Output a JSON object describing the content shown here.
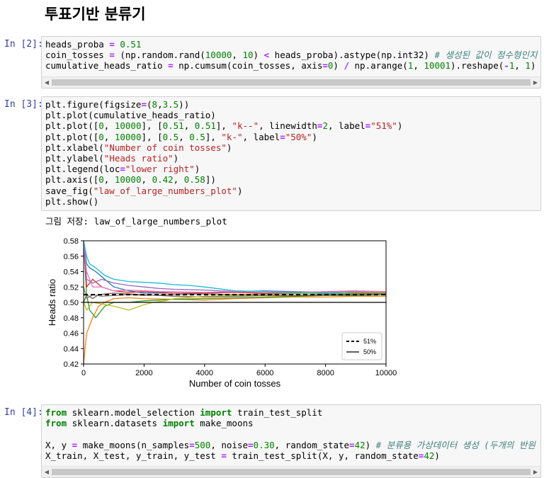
{
  "heading": "투표기반 분류기",
  "cells": {
    "c2": {
      "prompt": "In [2]:",
      "lines": [
        [
          [
            "heads_proba ",
            ""
          ],
          [
            "=",
            "op"
          ],
          [
            " ",
            ""
          ],
          [
            "0.51",
            "num"
          ]
        ],
        [
          [
            "coin_tosses ",
            ""
          ],
          [
            "=",
            "op"
          ],
          [
            " (np.random.rand(",
            ""
          ],
          [
            "10000",
            "num"
          ],
          [
            ", ",
            ""
          ],
          [
            "10",
            "num"
          ],
          [
            ") ",
            ""
          ],
          [
            "<",
            "op"
          ],
          [
            " heads_proba).astype(np.int32) ",
            ""
          ],
          [
            "# 생성된 값이 정수형인지 확",
            "cm"
          ]
        ],
        [
          [
            "cumulative_heads_ratio ",
            ""
          ],
          [
            "=",
            "op"
          ],
          [
            " np.cumsum(coin_tosses, axis",
            ""
          ],
          [
            "=",
            "op"
          ],
          [
            "0",
            "num"
          ],
          [
            ") ",
            ""
          ],
          [
            "/",
            "op"
          ],
          [
            " np.arange(",
            ""
          ],
          [
            "1",
            "num"
          ],
          [
            ", ",
            ""
          ],
          [
            "10001",
            "num"
          ],
          [
            ").reshape(",
            ""
          ],
          [
            "-",
            "op"
          ],
          [
            "1",
            "num"
          ],
          [
            ", ",
            ""
          ],
          [
            "1",
            "num"
          ],
          [
            ")",
            ""
          ]
        ]
      ]
    },
    "c3": {
      "prompt": "In [3]:",
      "lines": [
        [
          [
            "plt.figure(figsize",
            ""
          ],
          [
            "=",
            "op"
          ],
          [
            "(",
            ""
          ],
          [
            "8",
            "num"
          ],
          [
            ",",
            ""
          ],
          [
            "3.5",
            "num"
          ],
          [
            "))",
            ""
          ]
        ],
        [
          [
            "plt.plot(cumulative_heads_ratio)",
            ""
          ]
        ],
        [
          [
            "plt.plot([",
            ""
          ],
          [
            "0",
            "num"
          ],
          [
            ", ",
            ""
          ],
          [
            "10000",
            "num"
          ],
          [
            "], [",
            ""
          ],
          [
            "0.51",
            "num"
          ],
          [
            ", ",
            ""
          ],
          [
            "0.51",
            "num"
          ],
          [
            "], ",
            ""
          ],
          [
            "\"k--\"",
            "str"
          ],
          [
            ", linewidth",
            ""
          ],
          [
            "=",
            "op"
          ],
          [
            "2",
            "num"
          ],
          [
            ", label",
            ""
          ],
          [
            "=",
            "op"
          ],
          [
            "\"51%\"",
            "str"
          ],
          [
            ")",
            ""
          ]
        ],
        [
          [
            "plt.plot([",
            ""
          ],
          [
            "0",
            "num"
          ],
          [
            ", ",
            ""
          ],
          [
            "10000",
            "num"
          ],
          [
            "], [",
            ""
          ],
          [
            "0.5",
            "num"
          ],
          [
            ", ",
            ""
          ],
          [
            "0.5",
            "num"
          ],
          [
            "], ",
            ""
          ],
          [
            "\"k-\"",
            "str"
          ],
          [
            ", label",
            ""
          ],
          [
            "=",
            "op"
          ],
          [
            "\"50%\"",
            "str"
          ],
          [
            ")",
            ""
          ]
        ],
        [
          [
            "plt.xlabel(",
            ""
          ],
          [
            "\"Number of coin tosses\"",
            "str"
          ],
          [
            ")",
            ""
          ]
        ],
        [
          [
            "plt.ylabel(",
            ""
          ],
          [
            "\"Heads ratio\"",
            "str"
          ],
          [
            ")",
            ""
          ]
        ],
        [
          [
            "plt.legend(loc",
            ""
          ],
          [
            "=",
            "op"
          ],
          [
            "\"lower right\"",
            "str"
          ],
          [
            ")",
            ""
          ]
        ],
        [
          [
            "plt.axis([",
            ""
          ],
          [
            "0",
            "num"
          ],
          [
            ", ",
            ""
          ],
          [
            "10000",
            "num"
          ],
          [
            ", ",
            ""
          ],
          [
            "0.42",
            "num"
          ],
          [
            ", ",
            ""
          ],
          [
            "0.58",
            "num"
          ],
          [
            "])",
            ""
          ]
        ],
        [
          [
            "save_fig(",
            ""
          ],
          [
            "\"law_of_large_numbers_plot\"",
            "str"
          ],
          [
            ")",
            ""
          ]
        ],
        [
          [
            "plt.show()",
            ""
          ]
        ]
      ],
      "output": "그림 저장: law_of_large_numbers_plot"
    },
    "c4": {
      "prompt": "In [4]:",
      "lines": [
        [
          [
            "from",
            "kw"
          ],
          [
            " sklearn.model_selection ",
            ""
          ],
          [
            "import",
            "kw"
          ],
          [
            " train_test_split",
            ""
          ]
        ],
        [
          [
            "from",
            "kw"
          ],
          [
            " sklearn.datasets ",
            ""
          ],
          [
            "import",
            "kw"
          ],
          [
            " make_moons",
            ""
          ]
        ],
        [
          [
            "",
            ""
          ]
        ],
        [
          [
            "X, y ",
            ""
          ],
          [
            "=",
            "op"
          ],
          [
            " make_moons(n_samples",
            ""
          ],
          [
            "=",
            "op"
          ],
          [
            "500",
            "num"
          ],
          [
            ", noise",
            ""
          ],
          [
            "=",
            "op"
          ],
          [
            "0.30",
            "num"
          ],
          [
            ", random_state",
            ""
          ],
          [
            "=",
            "op"
          ],
          [
            "42",
            "num"
          ],
          [
            ") ",
            ""
          ],
          [
            "# 분류용 가상데이터 생성 (두개의 반원",
            "cm"
          ]
        ],
        [
          [
            "X_train, X_test, y_train, y_test ",
            ""
          ],
          [
            "=",
            "op"
          ],
          [
            " train_test_split(X, y, random_state",
            ""
          ],
          [
            "=",
            "op"
          ],
          [
            "42",
            "num"
          ],
          [
            ")",
            ""
          ]
        ]
      ]
    }
  },
  "chart_data": {
    "type": "line",
    "xlabel": "Number of coin tosses",
    "ylabel": "Heads ratio",
    "xlim": [
      0,
      10000
    ],
    "ylim": [
      0.42,
      0.58
    ],
    "xticks": [
      0,
      2000,
      4000,
      6000,
      8000,
      10000
    ],
    "yticks": [
      0.42,
      0.44,
      0.46,
      0.48,
      0.5,
      0.52,
      0.54,
      0.56,
      0.58
    ],
    "legend_loc": "lower right",
    "colors": [
      "#1f77b4",
      "#ff7f0e",
      "#2ca02c",
      "#d62728",
      "#9467bd",
      "#8c564b",
      "#e377c2",
      "#7f7f7f",
      "#bcbd22",
      "#17becf"
    ],
    "series": [
      {
        "x": [
          0,
          100,
          200,
          400,
          700,
          1000,
          1500,
          2000,
          3000,
          4000,
          5000,
          6000,
          7000,
          8000,
          9000,
          10000
        ],
        "values": [
          0.58,
          0.55,
          0.545,
          0.54,
          0.53,
          0.52,
          0.515,
          0.512,
          0.512,
          0.511,
          0.51,
          0.511,
          0.512,
          0.511,
          0.511,
          0.51
        ]
      },
      {
        "x": [
          0,
          50,
          100,
          200,
          300,
          500,
          700,
          1000,
          1500,
          2000,
          3000,
          4000,
          5000,
          6000,
          7000,
          8000,
          9000,
          10000
        ],
        "values": [
          0.42,
          0.44,
          0.46,
          0.47,
          0.48,
          0.495,
          0.5,
          0.505,
          0.506,
          0.505,
          0.504,
          0.503,
          0.505,
          0.506,
          0.507,
          0.507,
          0.508,
          0.508
        ]
      },
      {
        "x": [
          0,
          100,
          200,
          400,
          700,
          1000,
          1500,
          2000,
          2500,
          3000,
          4000,
          5000,
          6000,
          7000,
          8000,
          9000,
          10000
        ],
        "values": [
          0.58,
          0.51,
          0.49,
          0.48,
          0.495,
          0.5,
          0.5,
          0.502,
          0.503,
          0.504,
          0.505,
          0.506,
          0.507,
          0.508,
          0.509,
          0.509,
          0.51
        ]
      },
      {
        "x": [
          0,
          100,
          300,
          600,
          1000,
          1500,
          2000,
          2500,
          3000,
          4000,
          5000,
          6000,
          7000,
          8000,
          9000,
          10000
        ],
        "values": [
          0.58,
          0.52,
          0.53,
          0.52,
          0.515,
          0.513,
          0.514,
          0.513,
          0.512,
          0.512,
          0.513,
          0.512,
          0.512,
          0.511,
          0.512,
          0.512
        ]
      },
      {
        "x": [
          0,
          100,
          300,
          600,
          1000,
          1500,
          2000,
          2500,
          3000,
          4000,
          5000,
          6000,
          7000,
          8000,
          9000,
          10000
        ],
        "values": [
          0.58,
          0.53,
          0.525,
          0.53,
          0.525,
          0.522,
          0.52,
          0.518,
          0.517,
          0.516,
          0.514,
          0.515,
          0.514,
          0.513,
          0.514,
          0.514
        ]
      },
      {
        "x": [
          0,
          100,
          300,
          500,
          1000,
          1500,
          2000,
          3000,
          4000,
          5000,
          6000,
          7000,
          8000,
          9000,
          10000
        ],
        "values": [
          0.5,
          0.51,
          0.505,
          0.51,
          0.512,
          0.511,
          0.51,
          0.508,
          0.507,
          0.508,
          0.509,
          0.509,
          0.51,
          0.51,
          0.511
        ]
      },
      {
        "x": [
          0,
          100,
          300,
          600,
          1000,
          1500,
          2000,
          2500,
          3000,
          4000,
          5000,
          6000,
          7000,
          8000,
          9000,
          10000
        ],
        "values": [
          0.58,
          0.54,
          0.52,
          0.52,
          0.515,
          0.516,
          0.515,
          0.514,
          0.514,
          0.513,
          0.514,
          0.514,
          0.513,
          0.514,
          0.515,
          0.514
        ]
      },
      {
        "x": [
          0,
          100,
          300,
          600,
          1000,
          1500,
          2000,
          3000,
          4000,
          5000,
          6000,
          7000,
          8000,
          9000,
          10000
        ],
        "values": [
          0.52,
          0.505,
          0.51,
          0.508,
          0.509,
          0.51,
          0.509,
          0.51,
          0.511,
          0.51,
          0.511,
          0.512,
          0.511,
          0.511,
          0.511
        ]
      },
      {
        "x": [
          0,
          100,
          300,
          600,
          1000,
          1500,
          2000,
          2300,
          2700,
          3000,
          4000,
          5000,
          6000,
          7000,
          8000,
          9000,
          10000
        ],
        "values": [
          0.5,
          0.49,
          0.5,
          0.498,
          0.495,
          0.49,
          0.497,
          0.5,
          0.502,
          0.505,
          0.508,
          0.509,
          0.51,
          0.511,
          0.512,
          0.513,
          0.513
        ]
      },
      {
        "x": [
          0,
          100,
          200,
          400,
          700,
          1000,
          1500,
          2000,
          2500,
          3000,
          3500,
          4000,
          5000,
          6000,
          7000,
          8000,
          9000,
          10000
        ],
        "values": [
          0.58,
          0.56,
          0.55,
          0.545,
          0.535,
          0.53,
          0.527,
          0.526,
          0.525,
          0.523,
          0.522,
          0.52,
          0.515,
          0.514,
          0.513,
          0.512,
          0.511,
          0.511
        ]
      },
      {
        "name": "51%",
        "x": [
          0,
          10000
        ],
        "values": [
          0.51,
          0.51
        ],
        "style": "dashed",
        "color": "#000000"
      },
      {
        "name": "50%",
        "x": [
          0,
          10000
        ],
        "values": [
          0.5,
          0.5
        ],
        "style": "solid",
        "color": "#000000"
      }
    ]
  }
}
